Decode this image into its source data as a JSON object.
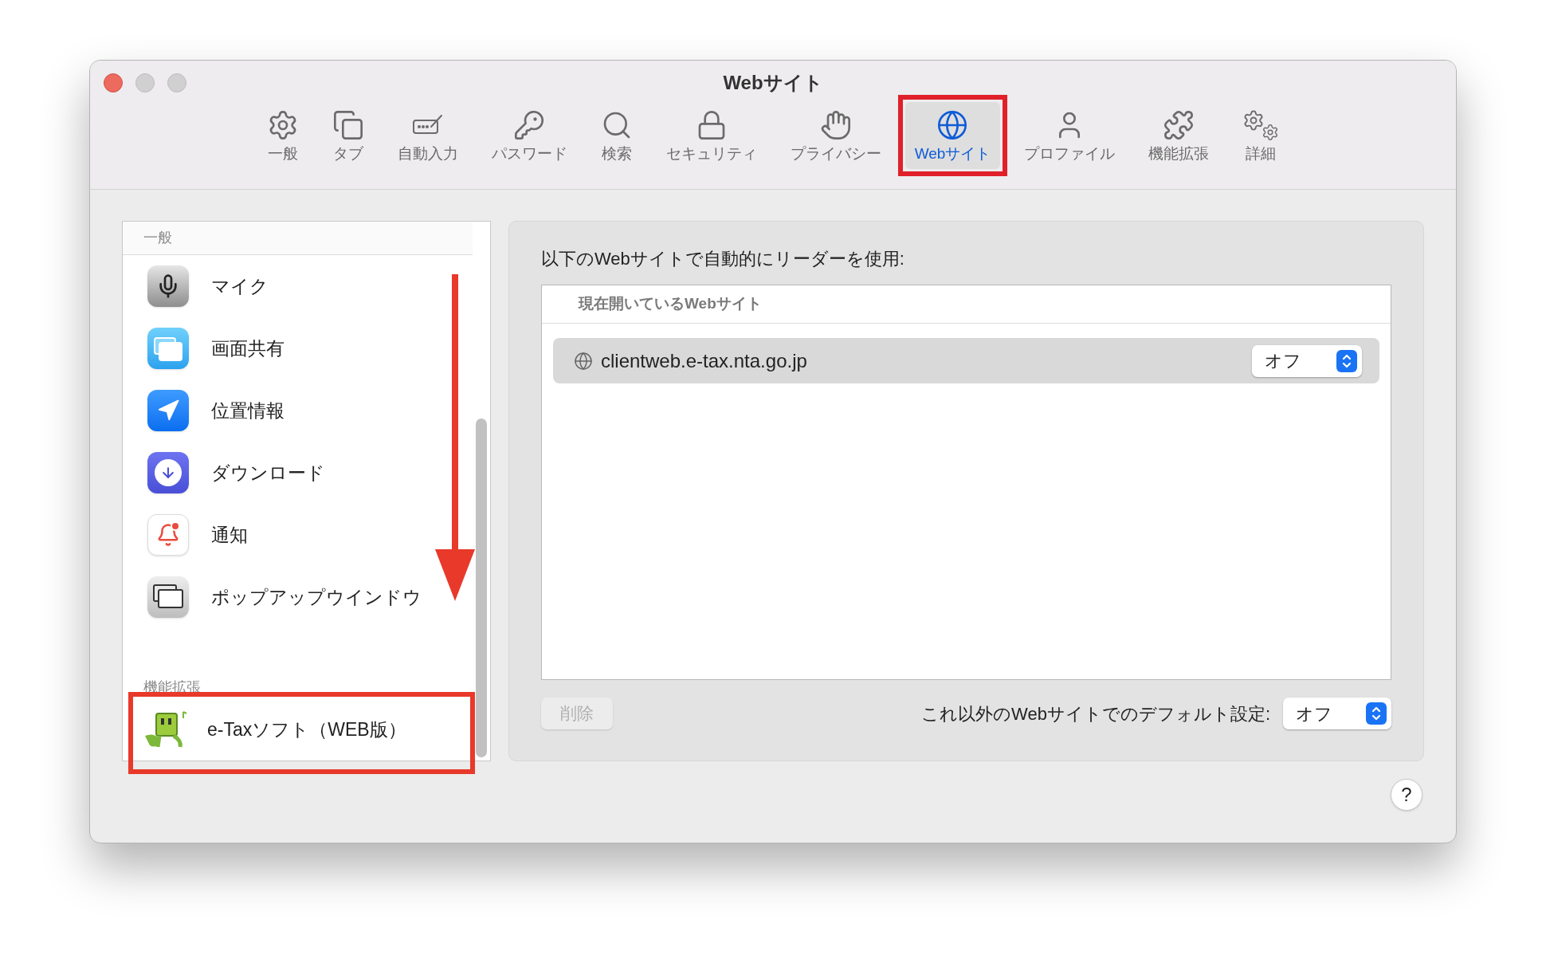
{
  "window": {
    "title": "Webサイト"
  },
  "toolbar": {
    "tabs": [
      {
        "label": "一般",
        "selected": false
      },
      {
        "label": "タブ",
        "selected": false
      },
      {
        "label": "自動入力",
        "selected": false
      },
      {
        "label": "パスワード",
        "selected": false
      },
      {
        "label": "検索",
        "selected": false
      },
      {
        "label": "セキュリティ",
        "selected": false
      },
      {
        "label": "プライバシー",
        "selected": false
      },
      {
        "label": "Webサイト",
        "selected": true
      },
      {
        "label": "プロファイル",
        "selected": false
      },
      {
        "label": "機能拡張",
        "selected": false
      },
      {
        "label": "詳細",
        "selected": false
      }
    ]
  },
  "sidebar": {
    "sections": [
      {
        "title": "一般",
        "items": [
          {
            "label": "マイク"
          },
          {
            "label": "画面共有"
          },
          {
            "label": "位置情報"
          },
          {
            "label": "ダウンロード"
          },
          {
            "label": "通知"
          },
          {
            "label": "ポップアップウインドウ"
          }
        ]
      },
      {
        "title": "機能拡張",
        "items": [
          {
            "label": "e-Taxソフト（WEB版）"
          }
        ]
      }
    ]
  },
  "panel": {
    "label": "以下のWebサイトで自動的にリーダーを使用:",
    "table": {
      "header": "現在開いているWebサイト",
      "rows": [
        {
          "site": "clientweb.e-tax.nta.go.jp",
          "setting": "オフ"
        }
      ]
    },
    "delete_button": {
      "label": "削除",
      "disabled": true
    },
    "default_setting": {
      "label": "これ以外のWebサイトでのデフォルト設定:",
      "value": "オフ"
    }
  },
  "help_button": "?"
}
